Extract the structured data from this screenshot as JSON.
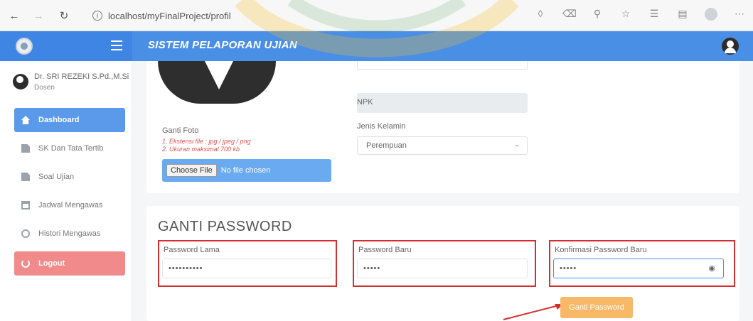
{
  "browser": {
    "url": "localhost/myFinalProject/profil",
    "info_icon": "info-icon",
    "back_icon": "arrow-left-icon",
    "forward_icon": "arrow-right-icon",
    "reload_icon": "reload-icon"
  },
  "header": {
    "title": "SISTEM PELAPORAN UJIAN"
  },
  "user": {
    "name": "Dr. SRI REZEKI S.Pd.,M.Si",
    "role": "Dosen"
  },
  "sidebar": {
    "items": [
      {
        "label": "Dashboard",
        "icon": "home-icon"
      },
      {
        "label": "SK Dan Tata Tertib",
        "icon": "document-icon"
      },
      {
        "label": "Soal Ujian",
        "icon": "document-icon"
      },
      {
        "label": "Jadwal Mengawas",
        "icon": "calendar-icon"
      },
      {
        "label": "Histori Mengawas",
        "icon": "history-icon"
      },
      {
        "label": "Logout",
        "icon": "power-icon"
      }
    ]
  },
  "profile": {
    "npk_label": "NPK",
    "jk_label": "Jenis Kelamin",
    "jk_value": "Perempuan",
    "photo_label": "Ganti Foto",
    "photo_note_1": "1. Ekstensi file : jpg / jpeg / png",
    "photo_note_2": "2. Ukuran maksimal 700 kb",
    "choose_file": "Choose File",
    "no_file": "No file chosen"
  },
  "password": {
    "title": "GANTI PASSWORD",
    "old_label": "Password Lama",
    "old_value": "••••••••••",
    "new_label": "Password Baru",
    "new_value": "•••••",
    "confirm_label": "Konfirmasi Password Baru",
    "confirm_value": "•••••",
    "save_label": "Ganti Password"
  },
  "colors": {
    "topbar": "#4a8fe6",
    "active_menu": "#5b9aea",
    "logout": "#f18a8a",
    "highlight_border": "#d42f2f",
    "save_button": "#f7b867"
  }
}
